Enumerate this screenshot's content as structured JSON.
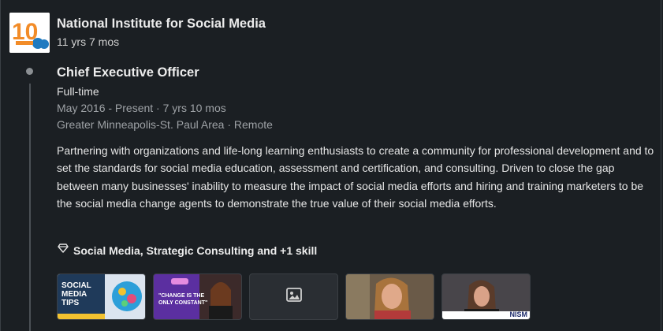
{
  "company": {
    "name": "National Institute for Social Media",
    "tenure": "11 yrs 7 mos"
  },
  "role": {
    "title": "Chief Executive Officer",
    "employment_type": "Full-time",
    "dates": "May 2016 - Present · 7 yrs 10 mos",
    "location": "Greater Minneapolis-St. Paul Area · Remote"
  },
  "description": "Partnering with organizations and life-long learning enthusiasts to create a community for professional development and to set the standards for social media education, assessment and certification, and consulting. Driven to close the gap between many businesses' inability to measure the impact of social media efforts and hiring and training marketers to be the social media change agents to demonstrate the true value of their social media efforts.",
  "skills": {
    "label": "Social Media, Strategic Consulting and +1 skill",
    "icon": "diamond-icon"
  },
  "media": {
    "t1_line1": "SOCIAL",
    "t1_line2": "MEDIA",
    "t1_line3": "TIPS",
    "t2_line1": "\"CHANGE IS THE",
    "t2_line2": "ONLY CONSTANT\"",
    "t5_tag": "NISM"
  },
  "colors": {
    "background": "#1b1f23",
    "logo_orange": "#f28c28",
    "logo_blue": "#1f7ac0"
  }
}
